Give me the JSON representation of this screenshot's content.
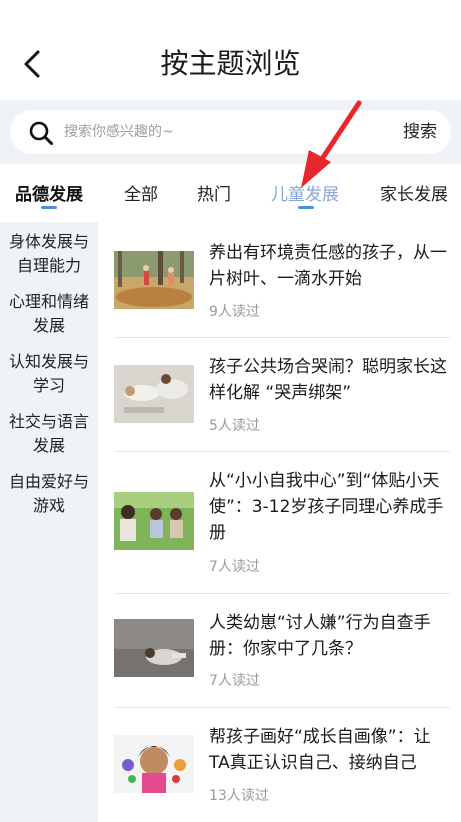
{
  "header": {
    "title": "按主题浏览",
    "back_icon": "chevron-left-icon"
  },
  "search": {
    "placeholder": "搜索你感兴趣的~",
    "button_label": "搜索",
    "icon": "search-icon"
  },
  "primary_category": {
    "label": "品德发展"
  },
  "tabs": [
    {
      "label": "全部"
    },
    {
      "label": "热门"
    },
    {
      "label": "儿童发展",
      "active": true
    },
    {
      "label": "家长发展"
    }
  ],
  "sidebar": {
    "items": [
      {
        "line1": "身体发展与",
        "line2": "自理能力"
      },
      {
        "line1": "心理和情绪",
        "line2": "发展"
      },
      {
        "line1": "认知发展与",
        "line2": "学习"
      },
      {
        "line1": "社交与语言",
        "line2": "发展"
      },
      {
        "line1": "自由爱好与",
        "line2": "游戏"
      }
    ]
  },
  "articles": [
    {
      "title": "养出有环境责任感的孩子，从一片树叶、一滴水开始",
      "reads": "9人读过"
    },
    {
      "title": "孩子公共场合哭闹？聪明家长这样化解 “哭声绑架”",
      "reads": "5人读过"
    },
    {
      "title": "从“小小自我中心”到“体贴小天使”：3-12岁孩子同理心养成手册",
      "reads": "7人读过"
    },
    {
      "title": "人类幼崽“讨人嫌”行为自查手册：你家中了几条？",
      "reads": "7人读过"
    },
    {
      "title": "帮孩子画好“成长自画像”：让TA真正认识自己、接纳自己",
      "reads": "13人读过"
    }
  ],
  "colors": {
    "accent": "#4f8ed9",
    "active_tab": "#8aa6d6",
    "annotation_arrow": "#e8262b",
    "panel_bg": "#eff2f7"
  }
}
